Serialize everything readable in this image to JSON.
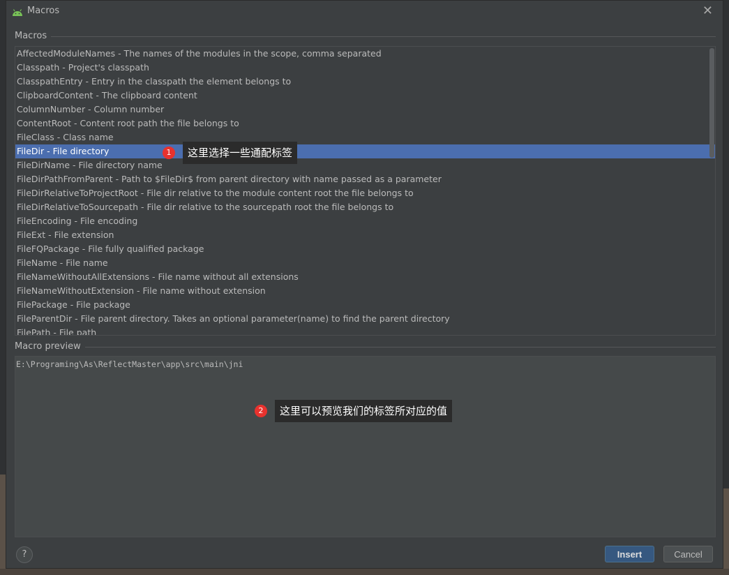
{
  "dialog": {
    "title": "Macros",
    "close_glyph": "✕"
  },
  "macros_group": {
    "label": "Macros",
    "items": [
      "AffectedModuleNames - The names of the modules in the scope, comma separated",
      "Classpath - Project's classpath",
      "ClasspathEntry - Entry in the classpath the element belongs to",
      "ClipboardContent - The clipboard content",
      "ColumnNumber - Column number",
      "ContentRoot - Content root path the file belongs to",
      "FileClass - Class name",
      "FileDir - File directory",
      "FileDirName - File directory name",
      "FileDirPathFromParent - Path to $FileDir$ from parent directory with name passed as a parameter",
      "FileDirRelativeToProjectRoot - File dir relative to the module content root the file belongs to",
      "FileDirRelativeToSourcepath - File dir relative to the sourcepath root the file belongs to",
      "FileEncoding - File encoding",
      "FileExt - File extension",
      "FileFQPackage - File fully qualified package",
      "FileName - File name",
      "FileNameWithoutAllExtensions - File name without all extensions",
      "FileNameWithoutExtension - File name without extension",
      "FilePackage - File package",
      "FileParentDir - File parent directory. Takes an optional parameter(name) to find the parent directory",
      "FilePath - File path"
    ],
    "selected_index": 7
  },
  "preview_group": {
    "label": "Macro preview",
    "value": "E:\\Programing\\As\\ReflectMaster\\app\\src\\main\\jni"
  },
  "annotations": [
    {
      "number": "1",
      "text": "这里选择一些通配标签"
    },
    {
      "number": "2",
      "text": "这里可以预览我们的标签所对应的值"
    }
  ],
  "footer": {
    "help_glyph": "?",
    "insert_label": "Insert",
    "cancel_label": "Cancel"
  },
  "icons": {
    "app": "android-icon",
    "close": "close-icon",
    "help": "help-icon"
  },
  "colors": {
    "selection": "#4b6eaf",
    "badge": "#e8322e",
    "insert_button": "#365880"
  }
}
